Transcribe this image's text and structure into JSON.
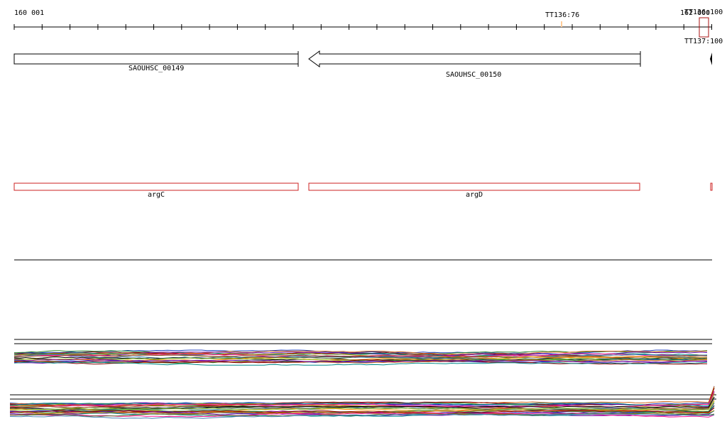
{
  "ruler": {
    "start_label": "160 001",
    "end_label": "162 000",
    "markers": [
      {
        "label": "TT136:76"
      },
      {
        "label": "TT136:100"
      },
      {
        "label": "TT137:100"
      }
    ]
  },
  "genes": [
    {
      "locus": "SAOUHSC_00149",
      "name": "argC",
      "strand": "+"
    },
    {
      "locus": "SAOUHSC_00150",
      "name": "argD",
      "strand": "-"
    }
  ],
  "colors": {
    "gene_outline": "#000000",
    "feature_outline": "#cc2222",
    "marker_box": "#aa1111",
    "tracks": [
      "#1f3fbf",
      "#2e8b2e",
      "#d2691e",
      "#8b0000",
      "#6a0dad",
      "#008b8b",
      "#b8860b",
      "#ff1493",
      "#556b2f",
      "#4682b4",
      "#a0522d",
      "#000000",
      "#ff8c00",
      "#2f4f4f",
      "#9acd32",
      "#8b008b"
    ]
  }
}
